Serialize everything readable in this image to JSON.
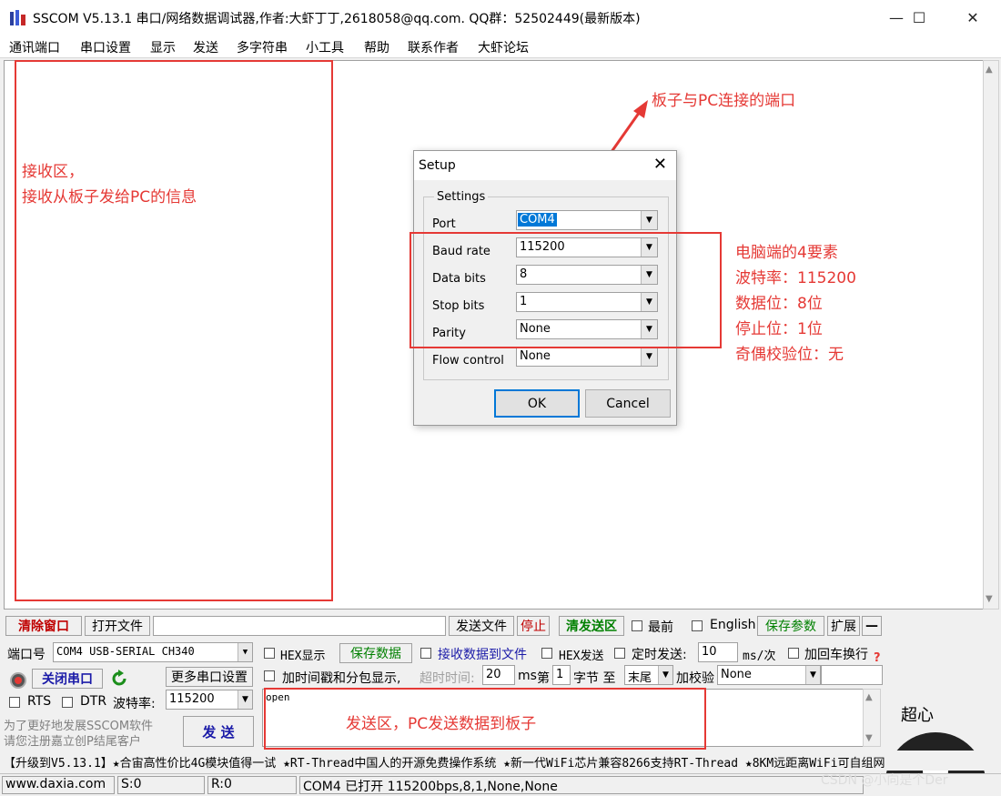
{
  "window": {
    "title": "SSCOM V5.13.1 串口/网络数据调试器,作者:大虾丁丁,2618058@qq.com. QQ群：52502449(最新版本)",
    "minimize": "—",
    "maximize": "☐",
    "close": "✕"
  },
  "menu": [
    "通讯端口",
    "串口设置",
    "显示",
    "发送",
    "多字符串",
    "小工具",
    "帮助",
    "联系作者",
    "大虾论坛"
  ],
  "annotations": {
    "recv_line1": "接收区，",
    "recv_line2": "接收从板子发给PC的信息",
    "port_note": "板子与PC连接的端口",
    "params_line1": "电脑端的4要素",
    "params_line2": "波特率：115200",
    "params_line3": "数据位：8位",
    "params_line4": "停止位：1位",
    "params_line5": "奇偶校验位：无",
    "send_note": "发送区，PC发送数据到板子"
  },
  "dialog": {
    "title": "Setup",
    "close": "✕",
    "group": "Settings",
    "port_label": "Port",
    "port_value": "COM4",
    "baud_label": "Baud rate",
    "baud_value": "115200",
    "data_label": "Data bits",
    "data_value": "8",
    "stop_label": "Stop bits",
    "stop_value": "1",
    "parity_label": "Parity",
    "parity_value": "None",
    "flow_label": "Flow control",
    "flow_value": "None",
    "ok": "OK",
    "cancel": "Cancel"
  },
  "toolbar": {
    "clear_window": "清除窗口",
    "open_file": "打开文件",
    "send_file": "发送文件",
    "stop": "停止",
    "clear_send": "清发送区",
    "topmost": "最前",
    "english": "English",
    "save_params": "保存参数",
    "expand": "扩展",
    "collapse": "—"
  },
  "controls": {
    "port_label": "端口号",
    "port_value": "COM4 USB-SERIAL CH340",
    "hex_display": "HEX显示",
    "save_data": "保存数据",
    "recv_to_file": "接收数据到文件",
    "hex_send": "HEX发送",
    "timed_send": "定时发送:",
    "interval": "10",
    "interval_unit": "ms/次",
    "add_crlf": "加回车换行",
    "close_port": "关闭串口",
    "more_settings": "更多串口设置",
    "timestamp": "加时间戳和分包显示,",
    "timeout_label": "超时时间:",
    "timeout_value": "20",
    "timeout_unit": "ms",
    "byte_prefix": "第",
    "byte_value": "1",
    "byte_suffix": "字节 至",
    "end_value": "末尾",
    "checksum_label": "加校验",
    "checksum_value": "None",
    "rts": "RTS",
    "dtr": "DTR",
    "baud_label": "波特率:",
    "baud_value": "115200",
    "promo_line1": "为了更好地发展SSCOM软件",
    "promo_line2": "请您注册嘉立创P结尾客户",
    "send_button": "发 送",
    "send_text": "open",
    "logo_text": "超心"
  },
  "news": "【升级到V5.13.1】★合宙高性价比4G模块值得一试 ★RT-Thread中国人的开源免费操作系统 ★新一代WiFi芯片兼容8266支持RT-Thread ★8KM远距离WiFi可自组网",
  "status": {
    "site": "www.daxia.com",
    "sent": "S:0",
    "recv": "R:0",
    "port_state": "COM4 已打开  115200bps,8,1,None,None",
    "watermark": "CSDN @小向是个Der"
  },
  "colors": {
    "accent_red": "#e53935",
    "green_text": "#008000",
    "dark_red_text": "#c00000",
    "select_blue": "#0078d7"
  }
}
